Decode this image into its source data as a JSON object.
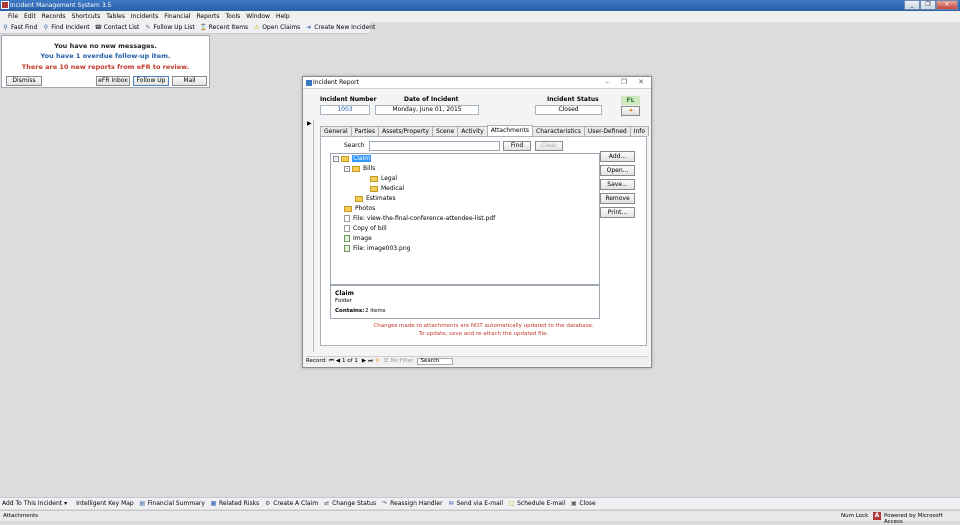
{
  "window": {
    "title": "Incident Management System 3.5",
    "buttons": [
      "_",
      "❐",
      "✕"
    ]
  },
  "menubar": {
    "items": [
      "File",
      "Edit",
      "Records",
      "Shortcuts",
      "Tables",
      "Incidents",
      "Financial",
      "Reports",
      "Tools",
      "Window",
      "Help"
    ]
  },
  "toolbar": {
    "items": [
      "Fast Find",
      "Find Incident",
      "Contact List",
      "Follow Up List",
      "Recent Items",
      "Open Claims",
      "Create New Incident"
    ]
  },
  "messages": {
    "line1": "You have no new messages.",
    "line2": "You have 1 overdue follow-up item.",
    "line3": "There are 10 new reports from eFR to review.",
    "dismiss": "Dismiss",
    "efr_inbox": "eFR Inbox",
    "follow_up": "Follow Up",
    "mail": "Mail"
  },
  "form": {
    "title": "Incident Report",
    "incident_number_label": "Incident Number",
    "incident_number": "1003",
    "date_label": "Date of Incident",
    "date": "Monday, June 01, 2015",
    "status_label": "Incident Status",
    "status": "Closed",
    "fl_badge": "FL",
    "tabs": [
      "General",
      "Parties",
      "Assets/Property",
      "Scene",
      "Activity",
      "Attachments",
      "Characteristics",
      "User-Defined",
      "Info"
    ],
    "search_label": "Search",
    "search_value": "",
    "find": "Find",
    "clear": "Clear",
    "tree": {
      "claim": "Claim",
      "bills": "Bills",
      "legal": "Legal",
      "medical": "Medical",
      "estimates": "Estimates",
      "photos": "Photos",
      "file1": "File: view-the-final-conference-attendee-list.pdf",
      "copy_bill": "Copy of bill",
      "image": "Image",
      "file2": "File: image003.png"
    },
    "info": {
      "name": "Claim",
      "type": "Folder",
      "contains_label": "Contains:",
      "contains_value": "2 items"
    },
    "side_buttons": {
      "add": "Add...",
      "open": "Open...",
      "save": "Save...",
      "remove": "Remove",
      "print": "Print..."
    },
    "note1": "Changes made to attachments are NOT automatically updated to the database.",
    "note2": "To update, save and re-attach the updated file.",
    "record_nav": {
      "label": "Record:",
      "position": "1 of 1",
      "filter": "No Filter",
      "search": "Search"
    }
  },
  "bottombar": {
    "items": [
      "Add To This Incident",
      "Intelligent Key Map",
      "Financial Summary",
      "Related Risks",
      "Create A Claim",
      "Change Status",
      "Reassign Handler",
      "Send via E-mail",
      "Schedule E-mail",
      "Close"
    ]
  },
  "statusbar": {
    "left": "Attachments",
    "num_lock": "Num Lock",
    "powered": "Powered by Microsoft Access"
  }
}
